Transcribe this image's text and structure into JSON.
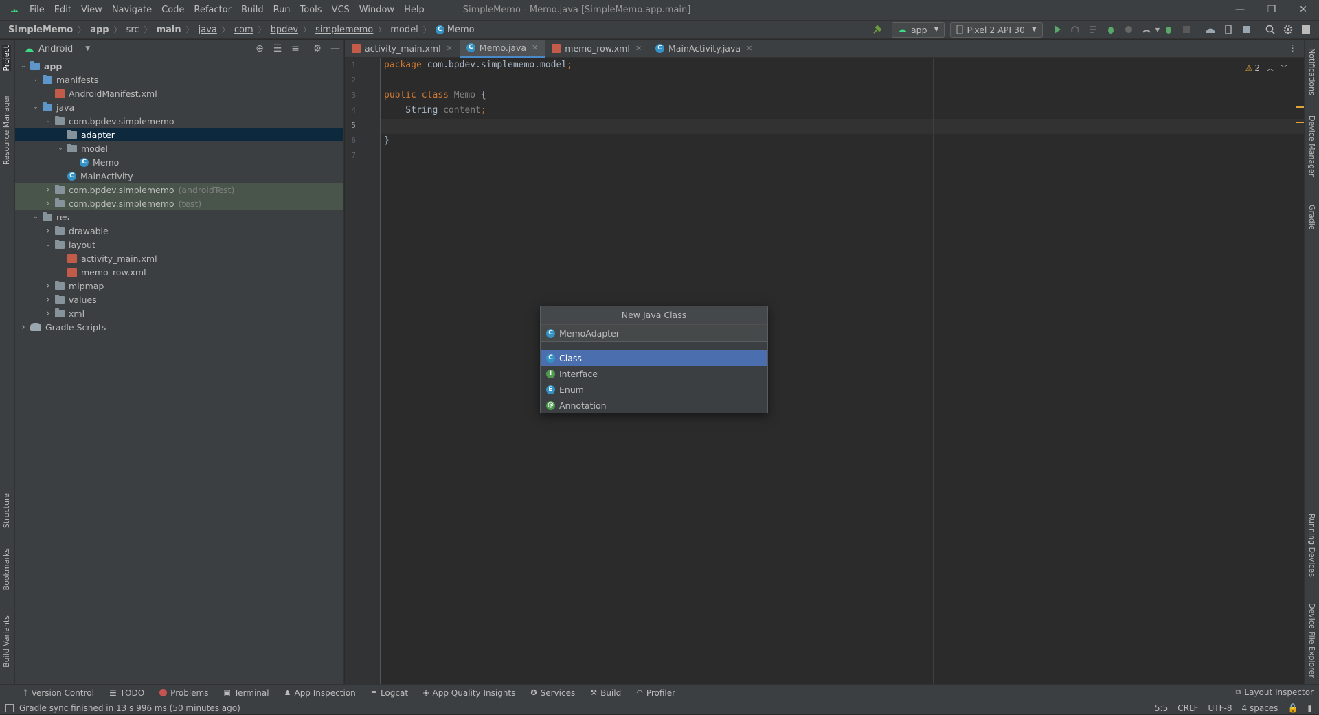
{
  "menubar": {
    "menus": [
      "File",
      "Edit",
      "View",
      "Navigate",
      "Code",
      "Refactor",
      "Build",
      "Run",
      "Tools",
      "VCS",
      "Window",
      "Help"
    ],
    "title": "SimpleMemo - Memo.java [SimpleMemo.app.main]",
    "controls": [
      "—",
      "❐",
      "✕"
    ]
  },
  "breadcrumbs": [
    "SimpleMemo",
    "app",
    "src",
    "main",
    "java",
    "com",
    "bpdev",
    "simplememo",
    "model",
    "Memo"
  ],
  "toolbar": {
    "run_config": "app",
    "device": "Pixel 2 API 30"
  },
  "left_stripe": [
    "Project",
    "Resource Manager",
    "Structure",
    "Bookmarks",
    "Build Variants"
  ],
  "right_stripe": [
    "Notifications",
    "Device Manager",
    "Gradle",
    "Running Devices",
    "Device File Explorer"
  ],
  "project": {
    "view": "Android",
    "tree": [
      {
        "label": "app",
        "level": 0,
        "type": "module",
        "open": true,
        "bold": true
      },
      {
        "label": "manifests",
        "level": 1,
        "type": "folder-blue",
        "open": true
      },
      {
        "label": "AndroidManifest.xml",
        "level": 2,
        "type": "xml"
      },
      {
        "label": "java",
        "level": 1,
        "type": "folder-blue",
        "open": true
      },
      {
        "label": "com.bpdev.simplememo",
        "level": 2,
        "type": "folder",
        "open": true
      },
      {
        "label": "adapter",
        "level": 3,
        "type": "folder",
        "selected": true
      },
      {
        "label": "model",
        "level": 3,
        "type": "folder",
        "open": true
      },
      {
        "label": "Memo",
        "level": 4,
        "type": "class"
      },
      {
        "label": "MainActivity",
        "level": 3,
        "type": "class"
      },
      {
        "label": "com.bpdev.simplememo",
        "level": 2,
        "type": "folder",
        "closed": true,
        "test": true,
        "suffix": "(androidTest)"
      },
      {
        "label": "com.bpdev.simplememo",
        "level": 2,
        "type": "folder",
        "closed": true,
        "test": true,
        "suffix": "(test)"
      },
      {
        "label": "res",
        "level": 1,
        "type": "folder",
        "open": true
      },
      {
        "label": "drawable",
        "level": 2,
        "type": "folder",
        "closed": true
      },
      {
        "label": "layout",
        "level": 2,
        "type": "folder",
        "open": true
      },
      {
        "label": "activity_main.xml",
        "level": 3,
        "type": "xml"
      },
      {
        "label": "memo_row.xml",
        "level": 3,
        "type": "xml"
      },
      {
        "label": "mipmap",
        "level": 2,
        "type": "folder",
        "closed": true
      },
      {
        "label": "values",
        "level": 2,
        "type": "folder",
        "closed": true
      },
      {
        "label": "xml",
        "level": 2,
        "type": "folder",
        "closed": true
      },
      {
        "label": "Gradle Scripts",
        "level": 0,
        "type": "gradle",
        "closed": true
      }
    ]
  },
  "tabs": [
    {
      "label": "activity_main.xml",
      "icon": "xml"
    },
    {
      "label": "Memo.java",
      "icon": "class",
      "active": true
    },
    {
      "label": "memo_row.xml",
      "icon": "xml"
    },
    {
      "label": "MainActivity.java",
      "icon": "class"
    }
  ],
  "editor": {
    "line_numbers": [
      "1",
      "2",
      "3",
      "4",
      "5",
      "6",
      "7"
    ],
    "warnings": "2",
    "lines": {
      "l1_kw": "package ",
      "l1_rest": "com.bpdev.simplememo.model",
      "l1_semi": ";",
      "l3_kw": "public class ",
      "l3_name": "Memo",
      "l3_brace": " {",
      "l4_type": "    String ",
      "l4_field": "content",
      "l4_semi": ";",
      "l6": "}"
    }
  },
  "popup": {
    "title": "New Java Class",
    "input_value": "MemoAdapter",
    "items": [
      {
        "label": "Class",
        "letter": "C",
        "color": "#3592c4",
        "selected": true
      },
      {
        "label": "Interface",
        "letter": "I",
        "color": "#4e9a4e"
      },
      {
        "label": "Enum",
        "letter": "E",
        "color": "#3592c4"
      },
      {
        "label": "Annotation",
        "letter": "@",
        "color": "#4e9a4e"
      }
    ]
  },
  "bottom_tools": [
    "Version Control",
    "TODO",
    "Problems",
    "Terminal",
    "App Inspection",
    "Logcat",
    "App Quality Insights",
    "Services",
    "Build",
    "Profiler"
  ],
  "layout_inspector": "Layout Inspector",
  "status": {
    "message": "Gradle sync finished in 13 s 996 ms (50 minutes ago)",
    "position": "5:5",
    "line_sep": "CRLF",
    "encoding": "UTF-8",
    "indent": "4 spaces"
  }
}
